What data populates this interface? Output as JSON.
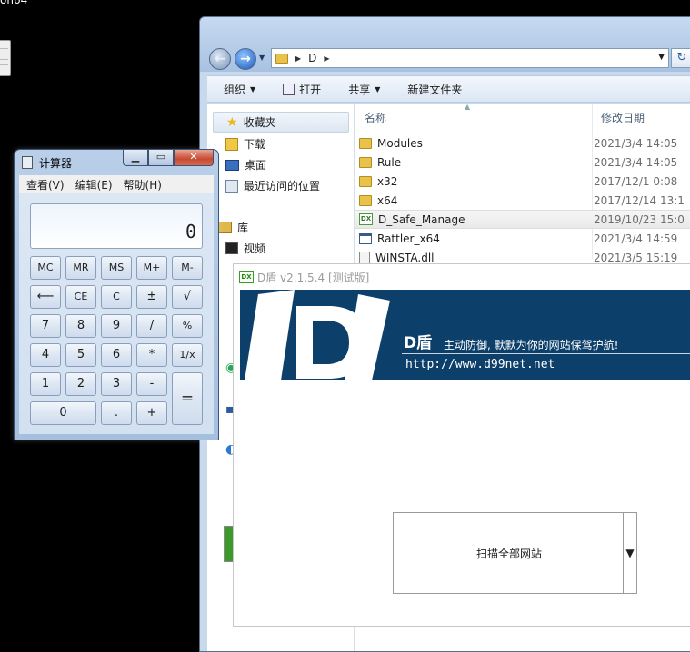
{
  "desktop": {
    "title_fragment": "on64"
  },
  "explorer": {
    "address": {
      "path": "D"
    },
    "toolbar": {
      "organize": "组织",
      "open": "打开",
      "share": "共享",
      "new_folder": "新建文件夹"
    },
    "nav": {
      "favorites": "收藏夹",
      "downloads": "下载",
      "desktop": "桌面",
      "recent": "最近访问的位置",
      "libraries": "库",
      "videos": "视频"
    },
    "columns": {
      "name": "名称",
      "modified": "修改日期"
    },
    "files": [
      {
        "name": "Modules",
        "date": "2021/3/4 14:05",
        "type": "folder"
      },
      {
        "name": "Rule",
        "date": "2021/3/4 14:05",
        "type": "folder"
      },
      {
        "name": "x32",
        "date": "2017/12/1 0:08",
        "type": "folder"
      },
      {
        "name": "x64",
        "date": "2017/12/14 13:1",
        "type": "folder"
      },
      {
        "name": "D_Safe_Manage",
        "date": "2019/10/23 15:0",
        "type": "exe"
      },
      {
        "name": "Rattler_x64",
        "date": "2021/3/4 14:59",
        "type": "app"
      },
      {
        "name": "WINSTA.dll",
        "date": "2021/3/5 15:19",
        "type": "dll"
      }
    ]
  },
  "dshield": {
    "title": "D盾 v2.1.5.4 [测试版]",
    "logo_small": "DX",
    "banner": {
      "name": "D盾",
      "slogan": "主动防御, 默默为你的网站保驾护航!",
      "url": "http://www.d99net.net"
    },
    "scan_select": {
      "value": "扫描全部网站"
    }
  },
  "calculator": {
    "title": "计算器",
    "menu": {
      "view": "查看(V)",
      "edit": "编辑(E)",
      "help": "帮助(H)"
    },
    "display": "0",
    "keys": {
      "mc": "MC",
      "mr": "MR",
      "ms": "MS",
      "mplus": "M+",
      "mminus": "M-",
      "back": "⟵",
      "ce": "CE",
      "c": "C",
      "pm": "±",
      "sqrt": "√",
      "k7": "7",
      "k8": "8",
      "k9": "9",
      "div": "/",
      "pct": "%",
      "k4": "4",
      "k5": "5",
      "k6": "6",
      "mul": "*",
      "inv": "1/x",
      "k1": "1",
      "k2": "2",
      "k3": "3",
      "sub": "-",
      "eq": "=",
      "k0": "0",
      "dot": ".",
      "add": "+"
    }
  },
  "colors": {
    "dshield_banner": "#0d3f6b",
    "calc_close": "#c74a33",
    "explorer_chrome": "#c9d9ec"
  }
}
